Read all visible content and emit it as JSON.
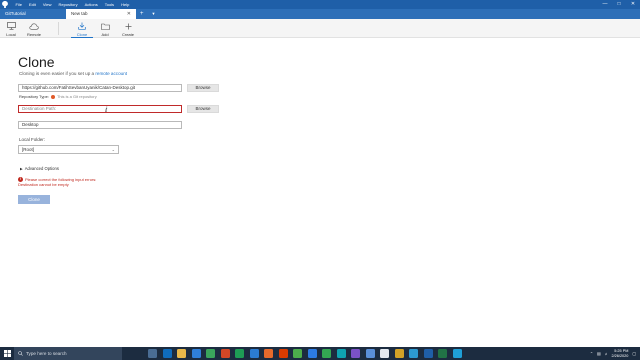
{
  "titlebar": {
    "menu": [
      "File",
      "Edit",
      "View",
      "Repository",
      "Actions",
      "Tools",
      "Help"
    ]
  },
  "tabs": [
    {
      "label": "GitTutorial",
      "active": false
    },
    {
      "label": "New tab",
      "active": true
    }
  ],
  "toolbar": {
    "items": [
      {
        "label": "Local",
        "icon": "monitor-icon"
      },
      {
        "label": "Remote",
        "icon": "cloud-icon"
      },
      {
        "label": "Clone",
        "icon": "download-icon",
        "active": true
      },
      {
        "label": "Add",
        "icon": "folder-icon"
      },
      {
        "label": "Create",
        "icon": "plus-icon"
      }
    ]
  },
  "clone": {
    "title": "Clone",
    "subtitle_text": "Cloning is even easier if you set up a ",
    "subtitle_link": "remote account",
    "url_value": "https://github.com/FatihSevbanUyanik/Catan-Desktop.git",
    "browse_label": "Browse",
    "repo_type_label": "Repository Type:",
    "repo_type_note": "This is a Git repository",
    "destination_placeholder": "Destination Path:",
    "name_value": "Desktop",
    "local_folder_label": "Local Folder:",
    "local_folder_value": "[Root]",
    "advanced_label": "Advanced Options",
    "error_line1": "Please correct the following input errors:",
    "error_line2": "Destination cannot be empty",
    "clone_button": "Clone"
  },
  "taskbar": {
    "search_placeholder": "Type here to search",
    "time": "5:25 PM",
    "date": "2/26/2020"
  }
}
